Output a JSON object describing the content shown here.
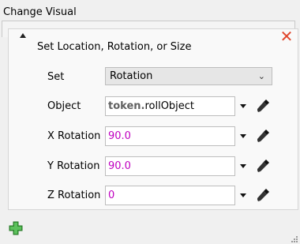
{
  "window": {
    "title": "Change Visual"
  },
  "section": {
    "title": "Set Location, Rotation, or Size"
  },
  "set": {
    "label": "Set",
    "value": "Rotation"
  },
  "object": {
    "label": "Object",
    "prefix": "token.",
    "value": "rollObject"
  },
  "x_rotation": {
    "label": "X Rotation",
    "value": "90.0"
  },
  "y_rotation": {
    "label": "Y Rotation",
    "value": "90.0"
  },
  "z_rotation": {
    "label": "Z Rotation",
    "value": "0"
  },
  "icons": {
    "close": "close-icon",
    "collapse": "collapse-triangle-icon",
    "dropdown": "dropdown-arrow-icon",
    "picker": "eyedropper-icon",
    "add": "add-plus-icon"
  },
  "colors": {
    "close": "#e0452b",
    "value": "#c000c0",
    "add": "#3aa03a"
  }
}
